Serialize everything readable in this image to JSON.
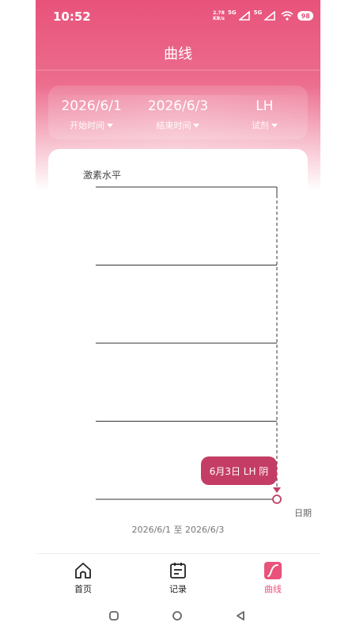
{
  "status_bar": {
    "time": "10:52",
    "net_speed": "2.78",
    "net_unit": "KB/s",
    "signal_1": "5G",
    "signal_2": "5G",
    "battery": "98"
  },
  "header": {
    "title": "曲线"
  },
  "filters": {
    "start": {
      "value": "2026/6/1",
      "label": "开始时间"
    },
    "end": {
      "value": "2026/6/3",
      "label": "结束时间"
    },
    "reagent": {
      "value": "LH",
      "label": "试剂"
    }
  },
  "chart_data": {
    "type": "line",
    "ylabel": "激素水平",
    "xlabel": "日期",
    "series": [
      {
        "values": []
      }
    ],
    "grid": true,
    "selected_point_label": "6月3日 LH 阴"
  },
  "range_text": "2026/6/1 至 2026/6/3",
  "bottom_nav": [
    {
      "label": "首页",
      "icon": "home-icon",
      "active": false
    },
    {
      "label": "记录",
      "icon": "calendar-record-icon",
      "active": false
    },
    {
      "label": "曲线",
      "icon": "curve-icon",
      "active": true
    }
  ],
  "colors": {
    "accent": "#e8527b",
    "tooltip": "#c43d65"
  }
}
